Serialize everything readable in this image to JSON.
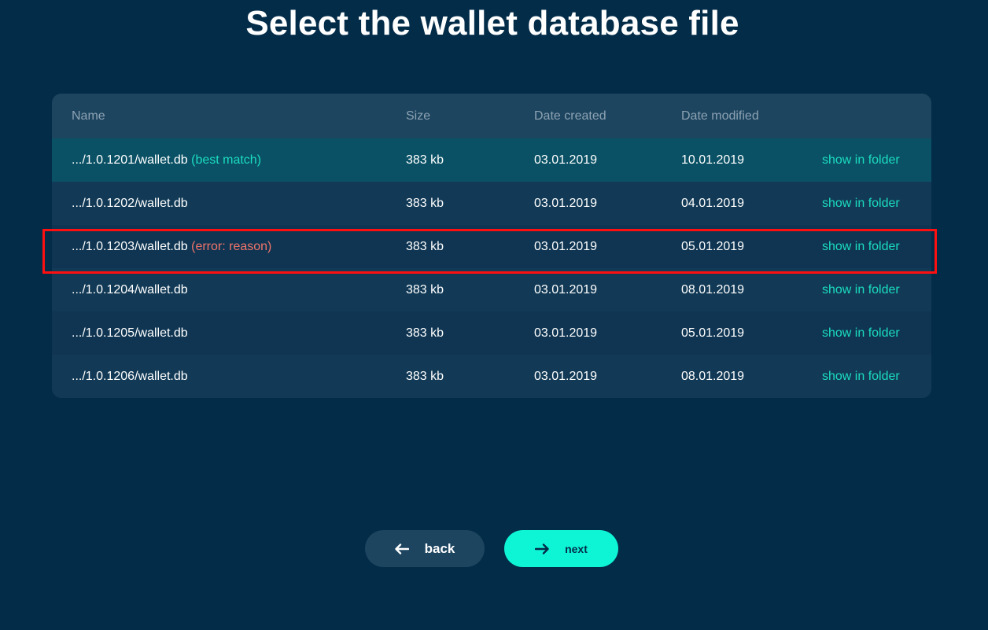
{
  "title": "Select the wallet database file",
  "table": {
    "headers": {
      "name": "Name",
      "size": "Size",
      "created": "Date created",
      "modified": "Date modified"
    },
    "rows": [
      {
        "name": ".../1.0.1201/wallet.db",
        "tag": "(best match)",
        "size": "383 kb",
        "created": "03.01.2019",
        "modified": "10.01.2019",
        "action": "show in folder"
      },
      {
        "name": ".../1.0.1202/wallet.db",
        "tag": "",
        "size": "383 kb",
        "created": "03.01.2019",
        "modified": "04.01.2019",
        "action": "show in folder"
      },
      {
        "name": ".../1.0.1203/wallet.db",
        "tag": "(error: reason)",
        "size": "383 kb",
        "created": "03.01.2019",
        "modified": "05.01.2019",
        "action": "show in folder"
      },
      {
        "name": ".../1.0.1204/wallet.db",
        "tag": "",
        "size": "383 kb",
        "created": "03.01.2019",
        "modified": "08.01.2019",
        "action": "show in folder"
      },
      {
        "name": ".../1.0.1205/wallet.db",
        "tag": "",
        "size": "383 kb",
        "created": "03.01.2019",
        "modified": "05.01.2019",
        "action": "show in folder"
      },
      {
        "name": ".../1.0.1206/wallet.db",
        "tag": "",
        "size": "383 kb",
        "created": "03.01.2019",
        "modified": "08.01.2019",
        "action": "show in folder"
      }
    ]
  },
  "buttons": {
    "back": {
      "label": "back",
      "icon": "arrow-left-icon"
    },
    "next": {
      "label": "next",
      "icon": "arrow-right-icon"
    }
  },
  "colors": {
    "background": "#032c49",
    "accent": "#0ef5d6",
    "link": "#1bdcc0",
    "error": "#f0746a",
    "highlight_border": "#ff1010"
  }
}
